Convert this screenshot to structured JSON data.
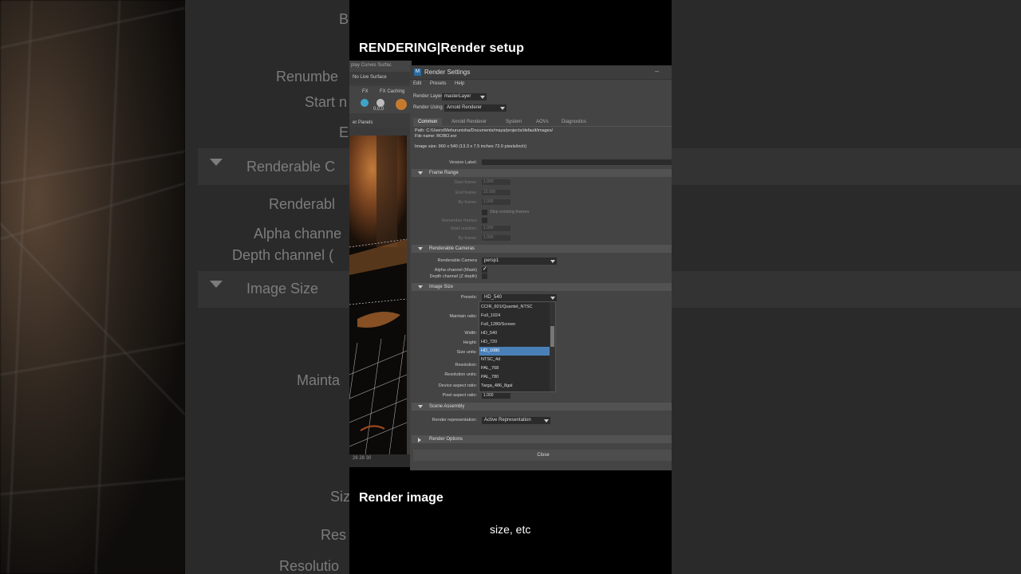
{
  "video": {
    "title": "RENDERING|Render setup",
    "caption_line1": "Render image",
    "caption_line2": "size, etc"
  },
  "background": {
    "left_fragments": [
      "B",
      "Renumbe",
      "Start n",
      "E",
      "Renderable C",
      "Renderabl",
      "Alpha channe",
      "Depth channel (",
      "Image Size",
      "Mainta",
      "Siz",
      "Res",
      "Resolutio"
    ]
  },
  "maya": {
    "menu": "play  Curves  Surfac",
    "live_surface": "No Live Surface",
    "fx": "FX",
    "fx_caching": "FX Caching",
    "coord": "0,0,0",
    "panels_menu": "er   Panels",
    "timeline": "26    28    30"
  },
  "window": {
    "title": "Render Settings",
    "menu": [
      "Edit",
      "Presets",
      "Help"
    ],
    "render_layer_label": "Render Layer",
    "render_layer_value": "masterLayer",
    "render_using_label": "Render Using",
    "render_using_value": "Arnold Renderer",
    "tabs": [
      "Common",
      "Arnold Renderer",
      "System",
      "AOVs",
      "Diagnostics"
    ],
    "path": "Path: C:/Users/Mehurunisha/Documents/maya/projects/default/images/",
    "file_name": "File name:  ROBO.exr",
    "image_size": "Image size: 960 x 540 (13.3 x 7.5 inches 72.0 pixels/inch)",
    "version_label": "Version Label:",
    "frame_range": {
      "title": "Frame Range",
      "start_frame_label": "Start frame:",
      "start_frame": "1.000",
      "end_frame_label": "End frame:",
      "end_frame": "10.000",
      "by_frame_label": "By frame:",
      "by_frame": "1.000",
      "skip_existing": "Skip existing frames",
      "renumber_label": "Renumber frames",
      "start_number_label": "Start number:",
      "start_number": "1.000",
      "by_frame2_label": "By frame:",
      "by_frame2": "1.000"
    },
    "renderable_cameras": {
      "title": "Renderable Cameras",
      "camera_label": "Renderable Camera",
      "camera_value": "persp1",
      "alpha_label": "Alpha channel (Mask)",
      "depth_label": "Depth channel (Z depth)"
    },
    "image_size_section": {
      "title": "Image Size",
      "presets_label": "Presets:",
      "presets_value": "HD_540",
      "maintain_ratio_label": "Maintain ratio:",
      "width_label": "Width:",
      "height_label": "Height:",
      "size_units_label": "Size units:",
      "resolution_label": "Resolution:",
      "resolution_units_label": "Resolution units:",
      "device_aspect_label": "Device aspect ratio:",
      "pixel_aspect_label": "Pixel aspect ratio:",
      "pixel_aspect_value": "1.000",
      "preset_options": [
        "CCIR_601/Quantel_NTSC",
        "Full_1024",
        "Full_1280/Screen",
        "HD_540",
        "HD_720",
        "HD_1080",
        "NTSC_4d",
        "PAL_768",
        "PAL_780",
        "Targa_486_8gal"
      ],
      "selected_option": "HD_1080"
    },
    "scene_assembly": {
      "title": "Scene Assembly",
      "rep_label": "Render representation:",
      "rep_value": "Active Representation"
    },
    "render_options": {
      "title": "Render Options"
    },
    "close_label": "Close"
  },
  "colors": {
    "selection": "#4a80b8",
    "window_bg": "#444444",
    "section_bg": "#525252"
  }
}
